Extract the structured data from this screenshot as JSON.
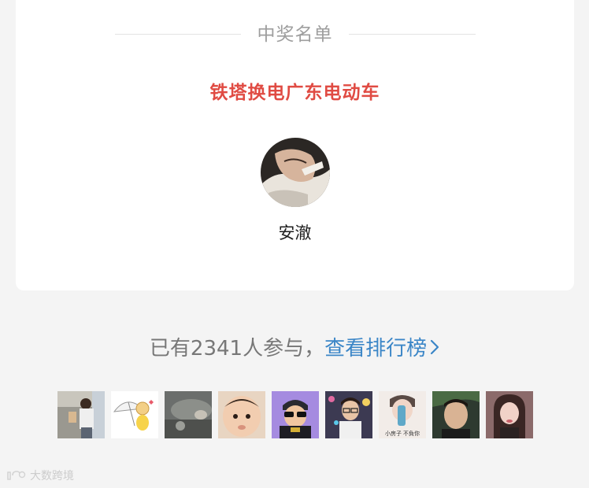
{
  "winners_section": {
    "title": "中奖名单",
    "prize_name": "铁塔换电广东电动车",
    "winner": {
      "name": "安澈"
    }
  },
  "participation": {
    "text": "已有2341人参与，",
    "ranking_link_label": "查看排行榜"
  },
  "participant_avatars": [
    {
      "icon": "avatar-photo-man-standing"
    },
    {
      "icon": "avatar-cartoon-umbrella"
    },
    {
      "icon": "avatar-photo-car-interior"
    },
    {
      "icon": "avatar-photo-baby"
    },
    {
      "icon": "avatar-cartoon-sunglasses"
    },
    {
      "icon": "avatar-photo-man-glasses"
    },
    {
      "icon": "avatar-photo-man-bottle",
      "caption": "小房子  不負你"
    },
    {
      "icon": "avatar-photo-man-dark"
    },
    {
      "icon": "avatar-photo-woman"
    }
  ],
  "watermark": {
    "text": "大数跨境"
  },
  "colors": {
    "accent_red": "#e04b43",
    "link_blue": "#3b86c7",
    "background": "#f4f4f4",
    "card": "#ffffff"
  }
}
